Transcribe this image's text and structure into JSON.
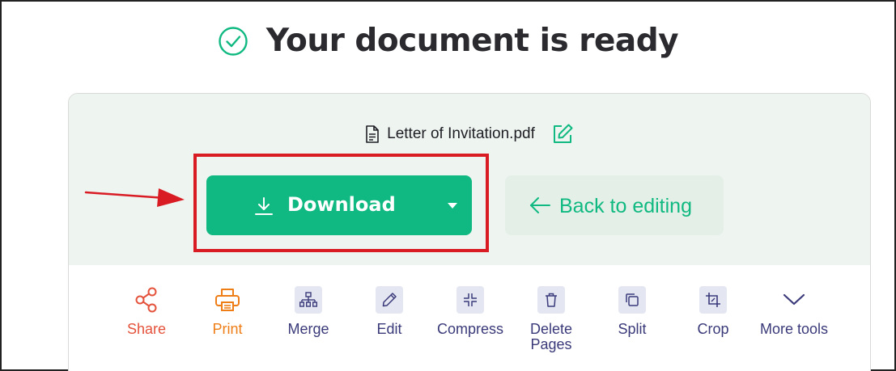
{
  "header": {
    "title": "Your document is ready",
    "check_icon": "check-circle-icon",
    "accent": "#10b981"
  },
  "file": {
    "name": "Letter of Invitation.pdf",
    "file_icon": "document-icon",
    "rename_icon": "pencil-square-icon"
  },
  "actions": {
    "download_label": "Download",
    "download_icon": "download-icon",
    "download_caret_icon": "caret-down-icon",
    "back_label": "Back to editing",
    "back_icon": "arrow-left-icon"
  },
  "annotation": {
    "highlight_color": "#d91c24",
    "arrow_icon": "red-arrow-icon"
  },
  "tools": [
    {
      "label": "Share",
      "icon": "share-icon",
      "color": "#e4523b"
    },
    {
      "label": "Print",
      "icon": "printer-icon",
      "color": "#ef7d16"
    },
    {
      "label": "Merge",
      "icon": "merge-icon"
    },
    {
      "label": "Edit",
      "icon": "pencil-icon"
    },
    {
      "label": "Compress",
      "icon": "compress-icon"
    },
    {
      "label": "Delete Pages",
      "icon": "trash-icon"
    },
    {
      "label": "Split",
      "icon": "split-icon"
    },
    {
      "label": "Crop",
      "icon": "crop-icon"
    },
    {
      "label": "More tools",
      "icon": "chevron-down-icon"
    }
  ]
}
